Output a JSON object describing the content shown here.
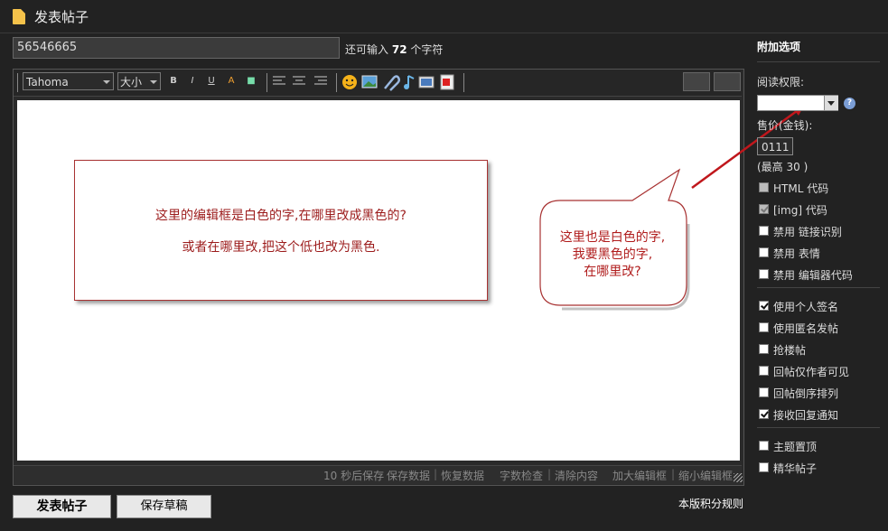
{
  "header": {
    "title": "发表帖子"
  },
  "subject": {
    "value": "56546665",
    "hint_prefix": "还可输入",
    "hint_count": "72",
    "hint_suffix": "个字符"
  },
  "toolbar": {
    "font": "Tahoma",
    "size": "大小",
    "small_buttons": [
      "B",
      "I",
      "U",
      "A",
      "■"
    ],
    "right_buttons": [
      "",
      ""
    ]
  },
  "status_links": [
    "10 秒后保存",
    "保存数据",
    "恢复数据",
    "字数检查",
    "清除内容",
    "加大编辑框",
    "缩小编辑框"
  ],
  "note": {
    "line1": "这里的编辑框是白色的字,在哪里改成黑色的?",
    "line2": "或者在哪里改,把这个低也改为黑色."
  },
  "bubble": {
    "line1": "这里也是白色的字,",
    "line2": "我要黑色的字,",
    "line3": "在哪里改?"
  },
  "buttons": {
    "submit": "发表帖子",
    "draft": "保存草稿",
    "rules": "本版积分规则"
  },
  "sidebar": {
    "title": "附加选项",
    "perm_label": "阅读权限:",
    "perm_value": "",
    "price_label": "售价(金钱):",
    "price_value": "0111",
    "price_max": "(最高 30 )",
    "group1": [
      {
        "label": "HTML 代码",
        "checked": false,
        "disabled": true
      },
      {
        "label": "[img] 代码",
        "checked": true,
        "disabled": true
      },
      {
        "label": "禁用 链接识别",
        "checked": false,
        "disabled": false
      },
      {
        "label": "禁用 表情",
        "checked": false,
        "disabled": false
      },
      {
        "label": "禁用 编辑器代码",
        "checked": false,
        "disabled": false
      }
    ],
    "group2": [
      {
        "label": "使用个人签名",
        "checked": true,
        "disabled": false
      },
      {
        "label": "使用匿名发帖",
        "checked": false,
        "disabled": false
      },
      {
        "label": "抢楼帖",
        "checked": false,
        "disabled": false
      },
      {
        "label": "回帖仅作者可见",
        "checked": false,
        "disabled": false
      },
      {
        "label": "回帖倒序排列",
        "checked": false,
        "disabled": false
      },
      {
        "label": "接收回复通知",
        "checked": true,
        "disabled": false
      }
    ],
    "group3": [
      {
        "label": "主题置顶",
        "checked": false,
        "disabled": false
      },
      {
        "label": "精华帖子",
        "checked": false,
        "disabled": false
      }
    ]
  },
  "colors": {
    "background": "#222222",
    "note_text": "#9c1c1c",
    "arrow": "#c0171c"
  }
}
